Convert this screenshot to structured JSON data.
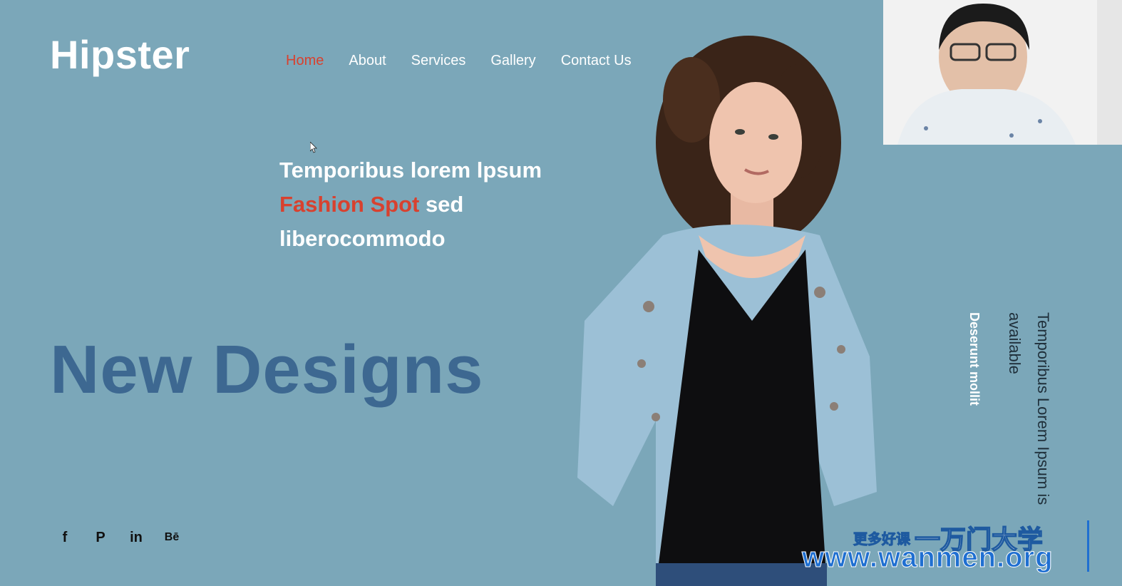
{
  "brand": {
    "logo": "Hipster"
  },
  "nav": {
    "items": [
      {
        "label": "Home",
        "active": true
      },
      {
        "label": "About",
        "active": false
      },
      {
        "label": "Services",
        "active": false
      },
      {
        "label": "Gallery",
        "active": false
      },
      {
        "label": "Contact Us",
        "active": false
      }
    ]
  },
  "hero": {
    "tagline_part1": "Temporibus lorem lpsum",
    "tagline_highlight": "Fashion Spot",
    "tagline_part2": " sed",
    "tagline_part3": "liberocommodo",
    "headline": "New Designs"
  },
  "social": {
    "icons": [
      {
        "name": "facebook-icon",
        "glyph": "f"
      },
      {
        "name": "pinterest-icon",
        "glyph": "P"
      },
      {
        "name": "linkedin-icon",
        "glyph": "in"
      },
      {
        "name": "behance-icon",
        "glyph": "Bē"
      }
    ]
  },
  "side_text": {
    "line1": "Deserunt mollit",
    "line2": "available",
    "line3": "Temporibus Lorem Ipsum is"
  },
  "watermark": {
    "small": "更多好课",
    "big": "一万门大学",
    "url": "www.wanmen.org"
  },
  "colors": {
    "background": "#7ba7b9",
    "accent": "#d8412f",
    "headline": "#3d6891"
  }
}
